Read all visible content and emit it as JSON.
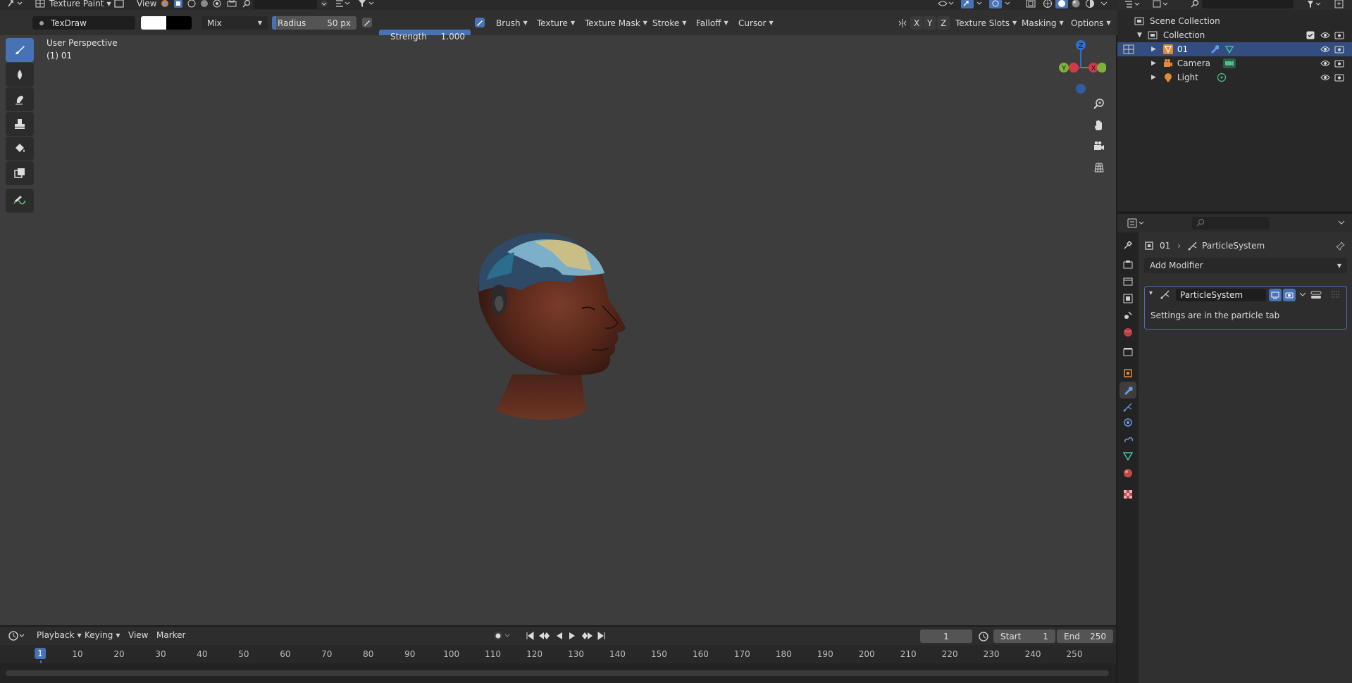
{
  "header": {
    "mode_label": "Texture Paint",
    "view_menu": "View"
  },
  "tool_settings": {
    "brush_name": "TexDraw",
    "color_primary": "#ffffff",
    "color_secondary": "#000000",
    "blend_mode": "Mix",
    "radius_label": "Radius",
    "radius_value": "50 px",
    "strength_label": "Strength",
    "strength_value": "1.000",
    "menus": [
      "Brush",
      "Texture",
      "Texture Mask",
      "Stroke",
      "Falloff",
      "Cursor"
    ],
    "axes": [
      "X",
      "Y",
      "Z"
    ],
    "right_menus": [
      "Texture Slots",
      "Masking",
      "Options"
    ]
  },
  "viewport": {
    "perspective_label": "User Perspective",
    "object_label": "(1) 01",
    "gizmo": {
      "z": "Z",
      "y": "Y",
      "x": "X"
    },
    "accent_color": "#4772b3"
  },
  "timeline": {
    "menus": [
      "Playback",
      "Keying",
      "View",
      "Marker"
    ],
    "current_frame": "1",
    "start_label": "Start",
    "start_value": "1",
    "end_label": "End",
    "end_value": "250",
    "ruler_marks": [
      "1",
      "10",
      "20",
      "30",
      "40",
      "50",
      "60",
      "70",
      "80",
      "90",
      "100",
      "110",
      "120",
      "130",
      "140",
      "150",
      "160",
      "170",
      "180",
      "190",
      "200",
      "210",
      "220",
      "230",
      "240",
      "250"
    ]
  },
  "outliner": {
    "scene_collection": "Scene Collection",
    "collection": "Collection",
    "items": [
      {
        "name": "01",
        "selected": true
      },
      {
        "name": "Camera",
        "selected": false
      },
      {
        "name": "Light",
        "selected": false
      }
    ]
  },
  "properties": {
    "breadcrumb_object": "01",
    "breadcrumb_modifier": "ParticleSystem",
    "add_modifier": "Add Modifier",
    "modifier_name": "ParticleSystem",
    "modifier_message": "Settings are in the particle tab"
  }
}
